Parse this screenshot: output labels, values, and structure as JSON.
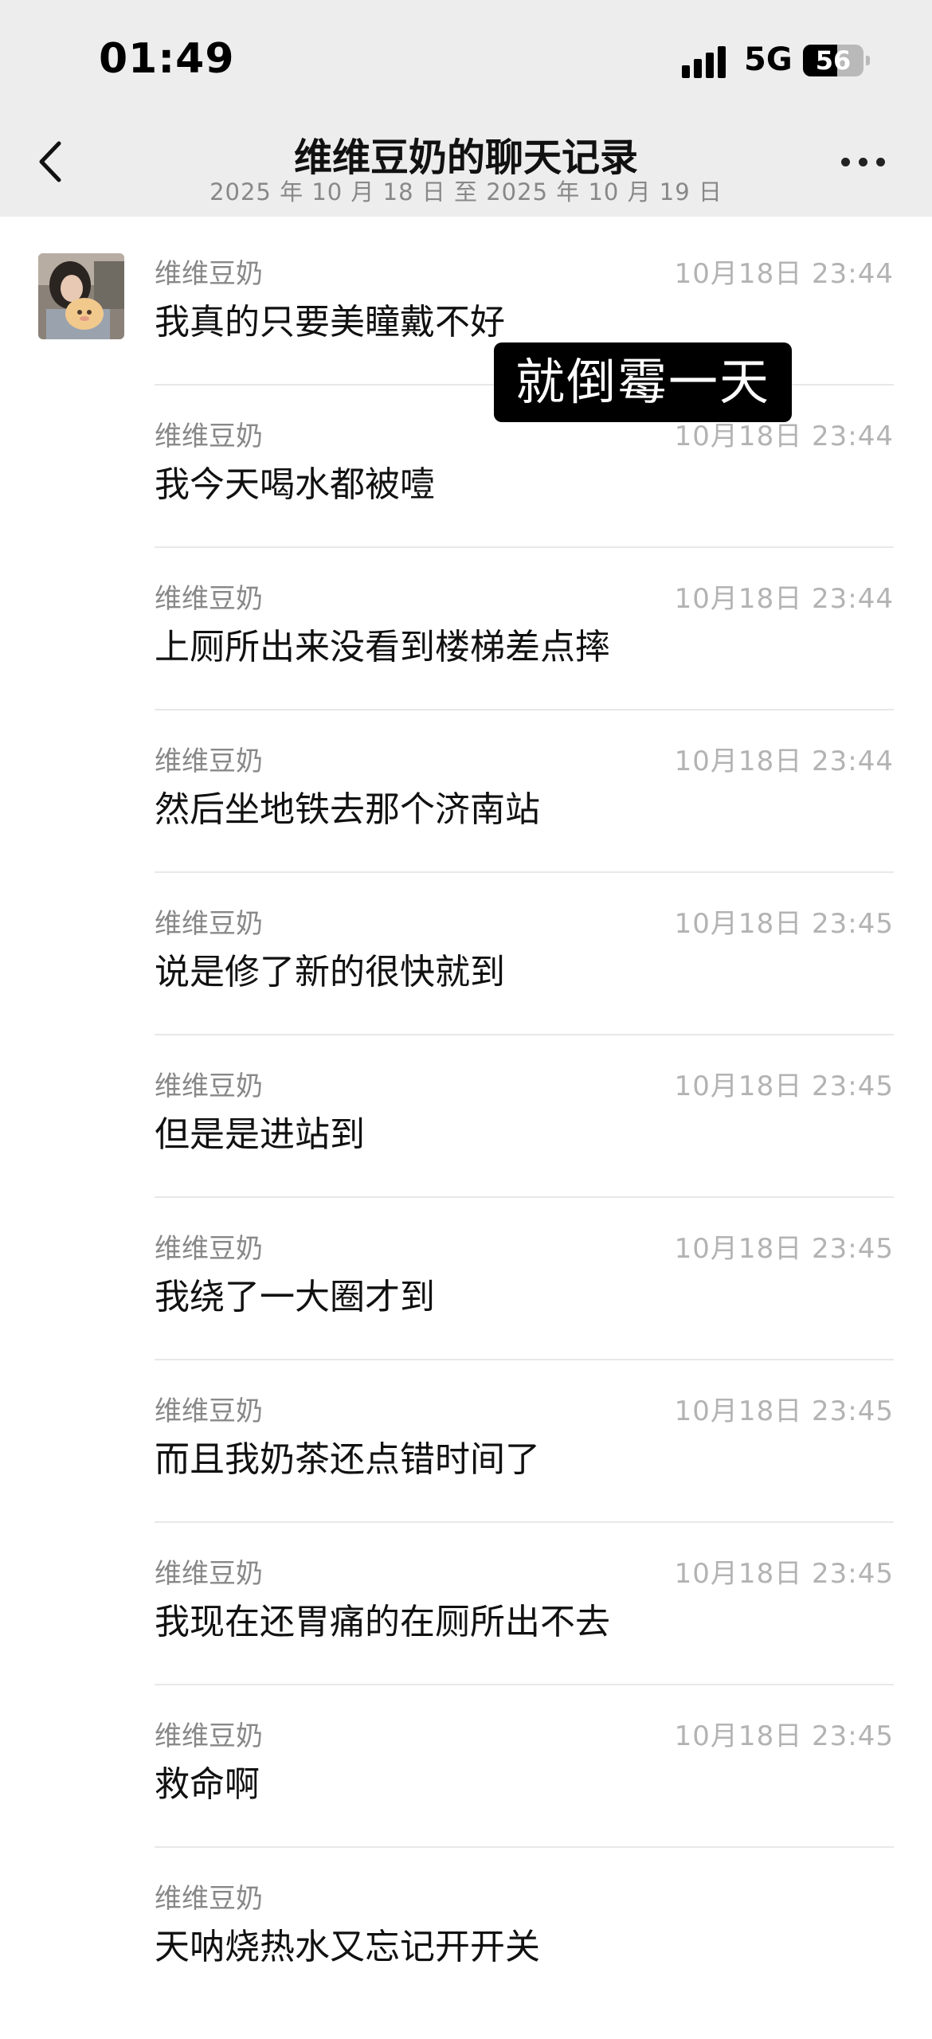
{
  "status_bar": {
    "time": "01:49",
    "network": "5G",
    "battery": "56",
    "battery_level_percent": 56
  },
  "nav": {
    "title": "维维豆奶的聊天记录",
    "subtitle": "2025 年 10 月 18 日 至 2025 年 10 月 19 日",
    "back_icon": "chevron-left-icon",
    "more_icon": "more-dots-icon"
  },
  "overlay_caption": "就倒霉一天",
  "messages": [
    {
      "sender": "维维豆奶",
      "time": "10月18日 23:44",
      "text": "我真的只要美瞳戴不好"
    },
    {
      "sender": "维维豆奶",
      "time": "10月18日 23:44",
      "text": "我今天喝水都被噎"
    },
    {
      "sender": "维维豆奶",
      "time": "10月18日 23:44",
      "text": "上厕所出来没看到楼梯差点摔"
    },
    {
      "sender": "维维豆奶",
      "time": "10月18日 23:44",
      "text": "然后坐地铁去那个济南站"
    },
    {
      "sender": "维维豆奶",
      "time": "10月18日 23:45",
      "text": "说是修了新的很快就到"
    },
    {
      "sender": "维维豆奶",
      "time": "10月18日 23:45",
      "text": "但是是进站到"
    },
    {
      "sender": "维维豆奶",
      "time": "10月18日 23:45",
      "text": "我绕了一大圈才到"
    },
    {
      "sender": "维维豆奶",
      "time": "10月18日 23:45",
      "text": "而且我奶茶还点错时间了"
    },
    {
      "sender": "维维豆奶",
      "time": "10月18日 23:45",
      "text": "我现在还胃痛的在厕所出不去"
    },
    {
      "sender": "维维豆奶",
      "time": "10月18日 23:45",
      "text": "救命啊"
    },
    {
      "sender": "维维豆奶",
      "time": "",
      "text": "天呐烧热水又忘记开开关"
    }
  ]
}
